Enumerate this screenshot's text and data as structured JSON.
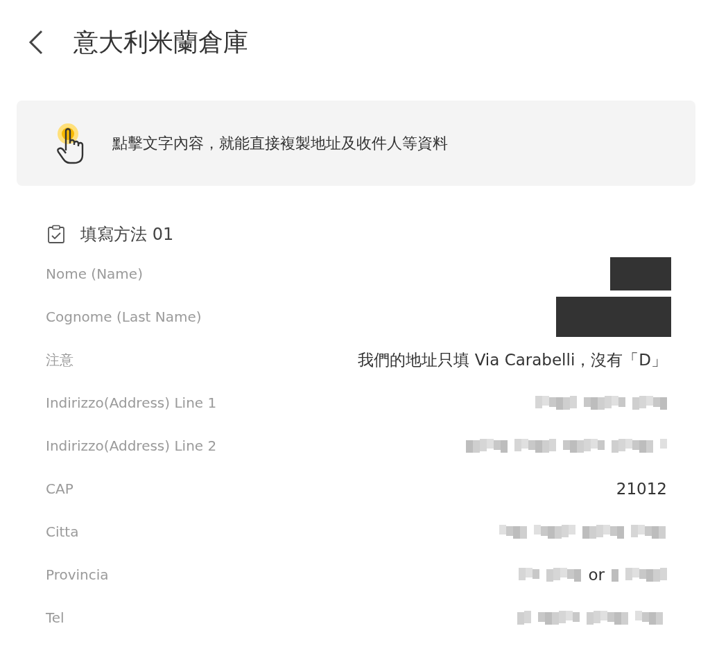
{
  "header": {
    "title": "意大利米蘭倉庫"
  },
  "hint": {
    "text": "點擊文字內容，就能直接複製地址及收件人等資料"
  },
  "section": {
    "title": "填寫方法 01"
  },
  "rows": [
    {
      "label": "Nome (Name)",
      "value": [
        {
          "kind": "redacted"
        }
      ]
    },
    {
      "label": "Cognome (Last Name)",
      "value": [
        {
          "kind": "redacted"
        }
      ]
    },
    {
      "label": "注意",
      "value": [
        {
          "kind": "text",
          "text": "我們的地址只填 Via Carabelli，沒有「D」"
        }
      ]
    },
    {
      "label": "Indirizzo(Address) Line 1",
      "value": [
        {
          "kind": "blurred"
        }
      ]
    },
    {
      "label": "Indirizzo(Address) Line 2",
      "value": [
        {
          "kind": "blurred"
        }
      ]
    },
    {
      "label": "CAP",
      "value": [
        {
          "kind": "text",
          "text": "21012"
        }
      ]
    },
    {
      "label": "Citta",
      "value": [
        {
          "kind": "blurred"
        }
      ]
    },
    {
      "label": "Provincia",
      "value": [
        {
          "kind": "blurred"
        },
        {
          "kind": "text",
          "text": "or"
        },
        {
          "kind": "blurred"
        }
      ]
    },
    {
      "label": "Tel",
      "value": [
        {
          "kind": "blurred"
        }
      ]
    }
  ]
}
